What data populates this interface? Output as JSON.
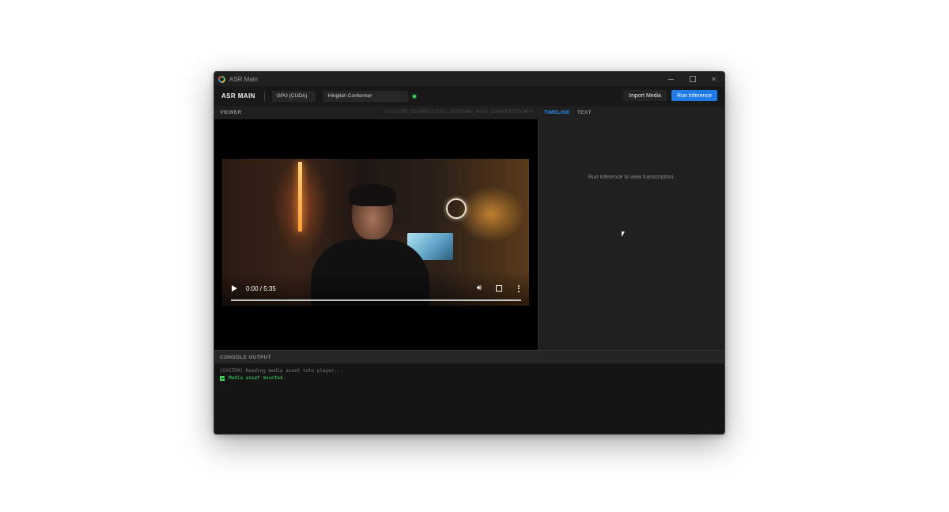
{
  "window": {
    "title": "ASR Main",
    "controls": [
      "minimize",
      "maximize",
      "close"
    ]
  },
  "toolbar": {
    "brand": "ASR MAIN",
    "device": "GPU (CUDA)",
    "model": "Hinglish Conformer",
    "status_color": "#3ddc57",
    "import_label": "Import Media",
    "run_label": "Run Inference",
    "accent_color": "#1e7ce8"
  },
  "viewer": {
    "label": "VIEWER",
    "file_name": "YOUTUBE_E1ARNQ17TSU_1920X960_H264_CONVERTED.MP4",
    "player": {
      "time": "0:00 / 5:35",
      "progress": 0
    }
  },
  "tabs": [
    {
      "label": "TIMELINE",
      "active": true
    },
    {
      "label": "TEXT",
      "active": false
    }
  ],
  "transcript": {
    "empty_message": "Run inference to view transcription."
  },
  "console": {
    "label": "CONSOLE OUTPUT",
    "lines": [
      {
        "type": "system",
        "text": "[SYSTEM] Reading media asset into player..."
      },
      {
        "type": "ok",
        "text": "Media asset mounted."
      }
    ]
  }
}
